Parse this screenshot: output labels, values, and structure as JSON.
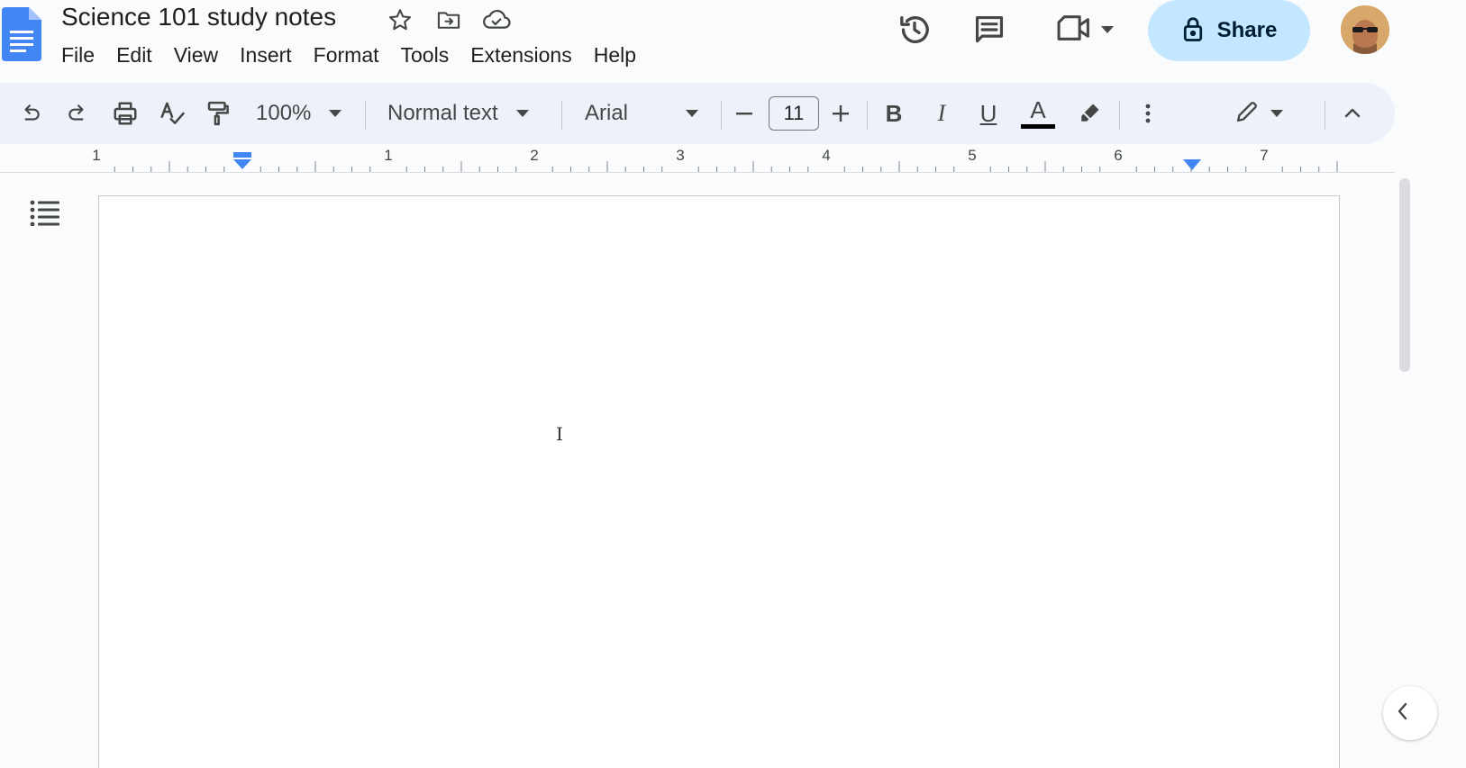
{
  "app": {
    "name": "Google Docs"
  },
  "document": {
    "title": "Science 101 study notes"
  },
  "title_icons": [
    "star-icon",
    "move-to-folder-icon",
    "cloud-saved-icon"
  ],
  "menu": [
    "File",
    "Edit",
    "View",
    "Insert",
    "Format",
    "Tools",
    "Extensions",
    "Help"
  ],
  "header": {
    "history_icon": "version-history-icon",
    "comments_icon": "comments-icon",
    "meet_icon": "meet-video-icon",
    "share_label": "Share",
    "share_color": "#c2e7ff"
  },
  "toolbar": {
    "zoom": "100%",
    "style": "Normal text",
    "font": "Arial",
    "font_size": "11",
    "text_color": "#000000",
    "background": "#edf2fa"
  },
  "ruler": {
    "labels": [
      "1",
      "1",
      "2",
      "3",
      "4",
      "5",
      "6",
      "7"
    ],
    "marker_color": "#4285f4"
  },
  "colors": {
    "accent": "#1a73e8",
    "page": "#ffffff",
    "canvas": "#f9fbfd"
  }
}
